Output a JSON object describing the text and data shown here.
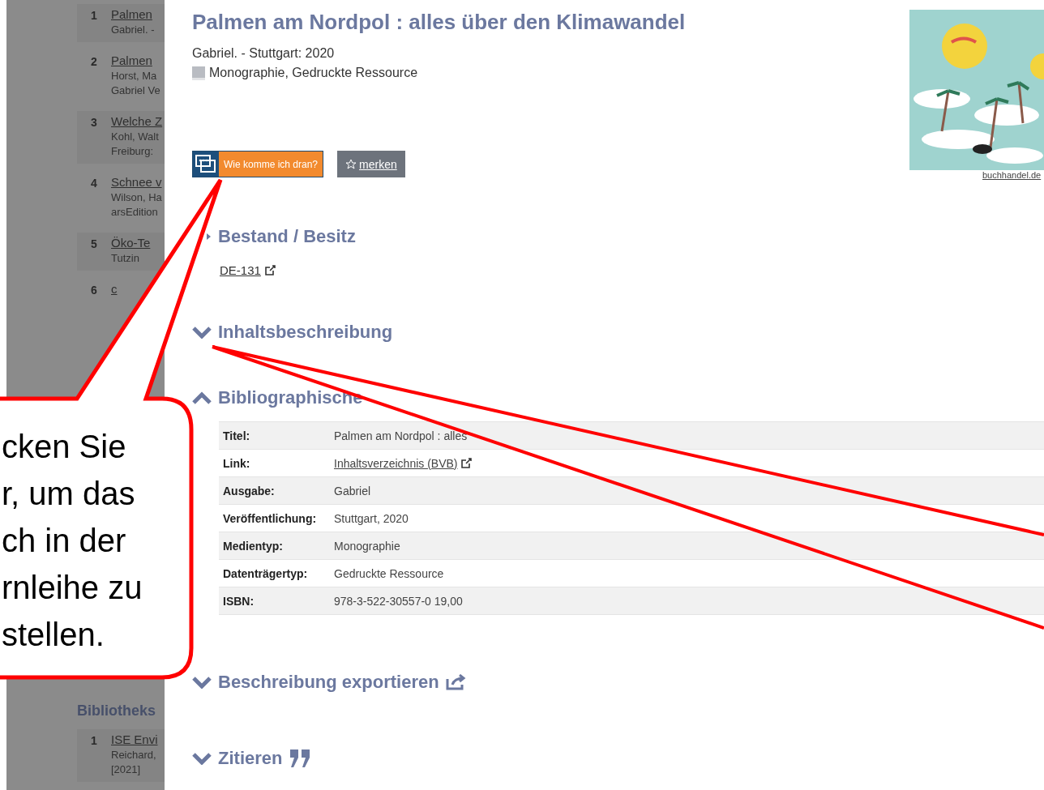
{
  "sidebar": {
    "results": [
      {
        "number": "1",
        "title": "Palmen",
        "lines": [
          "Gabriel. -"
        ]
      },
      {
        "number": "2",
        "title": "Palmen",
        "lines": [
          "Horst, Ma",
          "Gabriel Ve"
        ]
      },
      {
        "number": "3",
        "title": "Welche Z",
        "lines": [
          "Kohl, Walt",
          "Freiburg:"
        ]
      },
      {
        "number": "4",
        "title": "Schnee v",
        "lines": [
          "Wilson, Ha",
          "arsEdition"
        ]
      },
      {
        "number": "5",
        "title": "Öko-Te",
        "lines": [
          "Tutzin"
        ]
      },
      {
        "number": "6",
        "title": "c"
      }
    ],
    "section_title": "Bibliotheks",
    "library_results": [
      {
        "number": "1",
        "title": "ISE Envi",
        "lines": [
          "Reichard,",
          "[2021]"
        ]
      }
    ]
  },
  "record": {
    "title": "Palmen am Nordpol : alles über den Klimawandel",
    "publisher_line": "Gabriel. - Stuttgart: 2020",
    "media": "Monographie, Gedruckte Ressource",
    "buttons": [
      {
        "kind": "access",
        "label": "Wie komme ich dran?"
      },
      {
        "kind": "bookmark",
        "label": "merken"
      }
    ],
    "cover": {
      "kind": "picture",
      "caption": "buchhandel.de"
    }
  },
  "sections": [
    {
      "kind": "plain",
      "title": "Bestand / Besitz",
      "links": [
        "DE-131"
      ]
    },
    {
      "kind": "toggle",
      "title": "Inhaltsbeschreibung",
      "expanded": false
    },
    {
      "kind": "toggle",
      "title": "Bibliographische",
      "expanded": true,
      "rows": [
        {
          "kind": "text",
          "label": "Titel:",
          "value": "Palmen am Nordpol : alles"
        },
        {
          "kind": "link",
          "label": "Link:",
          "value": "Inhaltsverzeichnis (BVB)"
        },
        {
          "kind": "text",
          "label": "Ausgabe:",
          "value": "Gabriel"
        },
        {
          "kind": "text",
          "label": "Veröffentlichung:",
          "value": "Stuttgart, 2020"
        },
        {
          "kind": "text",
          "label": "Medientyp:",
          "value": "Monographie"
        },
        {
          "kind": "text",
          "label": "Datenträgertyp:",
          "value": "Gedruckte Ressource"
        },
        {
          "kind": "text",
          "label": "ISBN:",
          "value": "978-3-522-30557-0 19,00"
        }
      ]
    },
    {
      "kind": "export",
      "title": "Beschreibung exportieren",
      "expanded": false
    },
    {
      "kind": "quote",
      "title": "Zitieren",
      "expanded": false
    }
  ],
  "callout": {
    "lines": [
      "cken Sie",
      "r, um das",
      "ch in der",
      "rnleihe zu",
      "stellen."
    ]
  }
}
